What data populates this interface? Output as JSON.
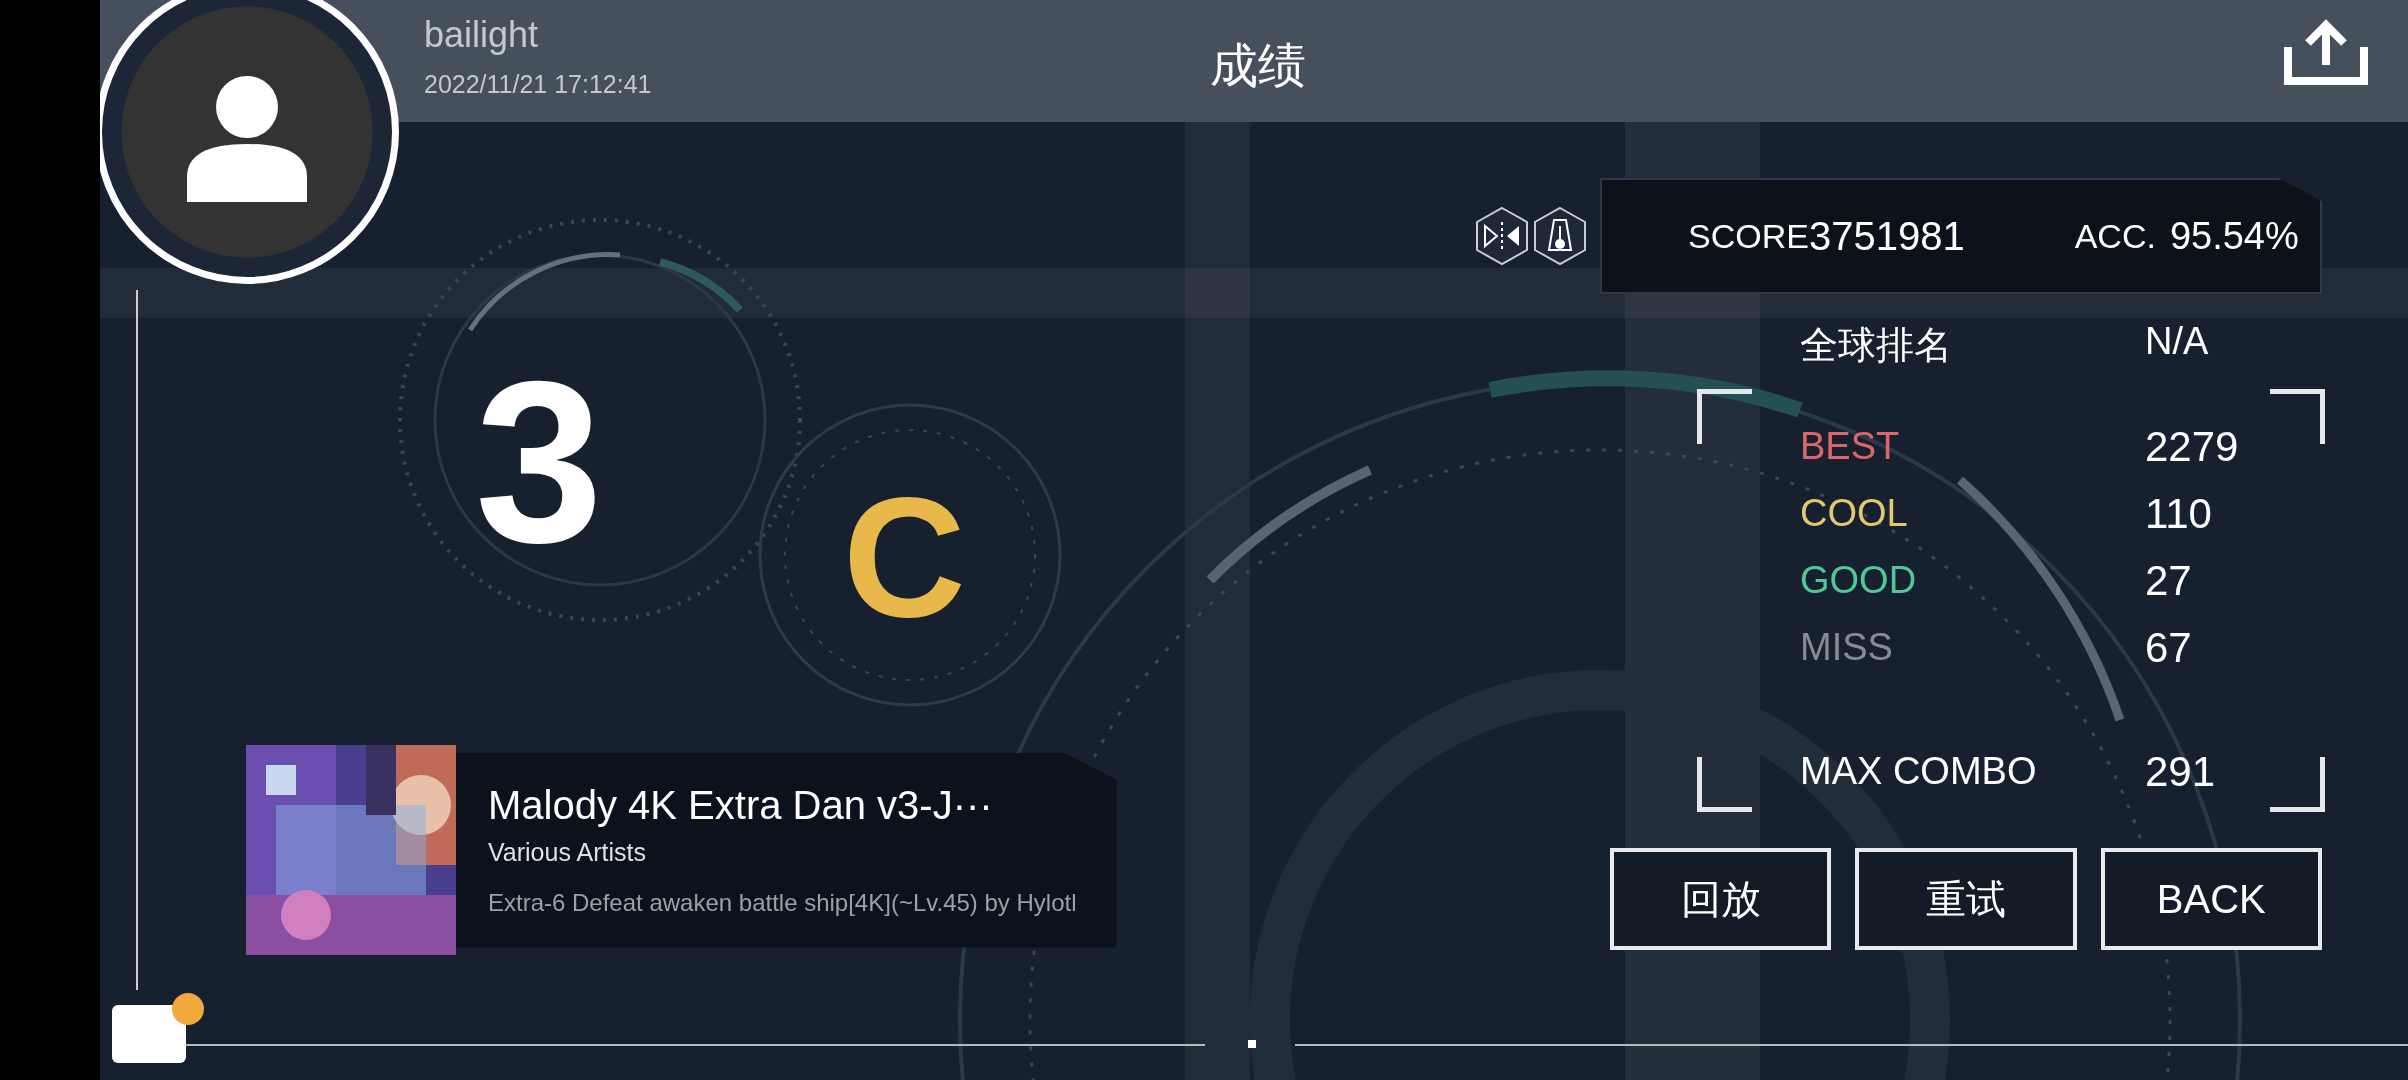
{
  "header": {
    "username": "bailight",
    "datetime": "2022/11/21 17:12:41",
    "title": "成绩"
  },
  "grades": {
    "primary": "3",
    "secondary": "C"
  },
  "score": {
    "label": "SCORE",
    "value": "3751981"
  },
  "accuracy": {
    "label": "ACC.",
    "value": "95.54%"
  },
  "global_rank": {
    "label": "全球排名",
    "value": "N/A"
  },
  "judgements": [
    {
      "label": "BEST",
      "value": "2279",
      "color": "#e0646c"
    },
    {
      "label": "COOL",
      "value": "110",
      "color": "#e6c770"
    },
    {
      "label": "GOOD",
      "value": "27",
      "color": "#4ec896"
    },
    {
      "label": "MISS",
      "value": "67",
      "color": "#878c94"
    }
  ],
  "max_combo": {
    "label": "MAX COMBO",
    "value": "291"
  },
  "buttons": [
    {
      "label": "回放"
    },
    {
      "label": "重试"
    },
    {
      "label": "BACK"
    }
  ],
  "song": {
    "title": "Malody 4K Extra Dan v3-J···",
    "artist": "Various Artists",
    "chart": "Extra-6 Defeat awaken battle ship[4K](~Lv.45) by Hylotl"
  },
  "chat": {
    "unread": true
  }
}
